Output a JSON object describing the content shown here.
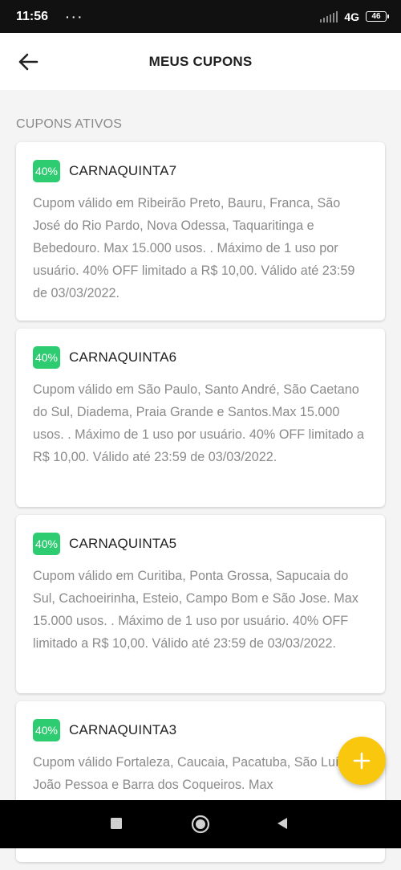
{
  "status_bar": {
    "time": "11:56",
    "dots": "···",
    "network": "4G",
    "battery": "46"
  },
  "header": {
    "title": "MEUS CUPONS"
  },
  "section": {
    "label": "CUPONS ATIVOS"
  },
  "coupons": [
    {
      "badge": "40%",
      "code": "CARNAQUINTA7",
      "description": "Cupom válido em Ribeirão Preto, Bauru, Franca, São José do Rio Pardo, Nova Odessa, Taquaritinga e Bebedouro. Max 15.000 usos. . Máximo de 1 uso por usuário. 40% OFF limitado a R$ 10,00. Válido até 23:59 de 03/03/2022."
    },
    {
      "badge": "40%",
      "code": "CARNAQUINTA6",
      "description": "Cupom válido em São Paulo, Santo André, São Caetano do Sul, Diadema, Praia Grande e Santos.Max 15.000 usos. . Máximo de 1 uso por usuário. 40% OFF limitado a R$ 10,00. Válido até 23:59 de 03/03/2022."
    },
    {
      "badge": "40%",
      "code": "CARNAQUINTA5",
      "description": "Cupom válido em Curitiba, Ponta Grossa, Sapucaia do Sul, Cachoeirinha, Esteio, Campo Bom e São Jose. Max 15.000 usos. . Máximo de 1 uso por usuário. 40% OFF limitado a R$ 10,00. Válido até 23:59 de 03/03/2022."
    },
    {
      "badge": "40%",
      "code": "CARNAQUINTA3",
      "description": "Cupom válido Fortaleza, Caucaia, Pacatuba, São Luís, João Pessoa e Barra dos Coqueiros. Max"
    }
  ],
  "colors": {
    "badge": "#2ecc71",
    "fab": "#f9c80e",
    "muted_text": "#8a8a8a"
  },
  "icons": {
    "back": "arrow-left-icon",
    "fab": "plus-icon",
    "nav_recents": "square-icon",
    "nav_home": "circle-icon",
    "nav_back": "triangle-left-icon"
  }
}
